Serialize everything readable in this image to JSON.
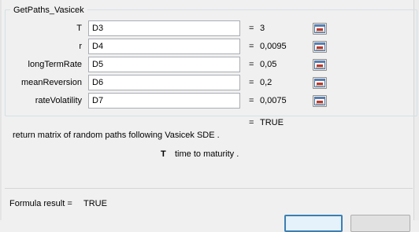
{
  "dialog": {
    "function_name": "GetPaths_Vasicek",
    "arguments": [
      {
        "label": "T",
        "ref": "D3",
        "value": "3"
      },
      {
        "label": "r",
        "ref": "D4",
        "value": "0,0095"
      },
      {
        "label": "longTermRate",
        "ref": "D5",
        "value": "0,05"
      },
      {
        "label": "meanReversion",
        "ref": "D6",
        "value": "0,2"
      },
      {
        "label": "rateVolatility",
        "ref": "D7",
        "value": "0,0075"
      }
    ],
    "equals": "=",
    "function_result": "TRUE",
    "description": "return matrix of random paths following Vasicek SDE .",
    "arg_help_name": "T",
    "arg_help_text": "time to maturity .",
    "formula_result_label": "Formula result =",
    "formula_result_value": "TRUE",
    "icons": {
      "collapse": "collapse-dialog-icon"
    },
    "colors": {
      "accent": "#3c7fb1",
      "dialog_bg": "#f0f0f0"
    }
  }
}
